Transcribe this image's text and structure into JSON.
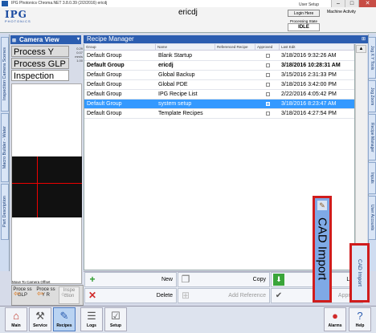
{
  "window": {
    "title": "IPG Photonics Chroma.NET 3.8.0.39 (2/2/2016)    ericdj",
    "minimize": "–",
    "maximize": "□",
    "close": "✕"
  },
  "header": {
    "logo_main": "IPG",
    "logo_sub": "PHOTONICS",
    "username": "ericdj",
    "user_setup": "User Setup",
    "login_button": "Login Here",
    "processing_state_label": "Processing State",
    "processing_state": "IDLE",
    "machine_activity": "Machine Activity"
  },
  "left_tabs": [
    "Inspection Camera Scenes",
    "Macro Builder - Water",
    "Part Description"
  ],
  "camera": {
    "title": "Camera View",
    "modes": [
      "Process Y",
      "Process GLP",
      "Inspection"
    ],
    "readouts": [
      "0.29",
      "0.07",
      "mm/s",
      "1.00"
    ],
    "move_offset_label": "Move To Camera Offset",
    "move_buttons": [
      {
        "label": "Proce ss GLP"
      },
      {
        "label": "Proce ss Y R"
      },
      {
        "label": "Inspe ction"
      }
    ]
  },
  "recipe_manager": {
    "title": "Recipe Manager",
    "columns": [
      "Group",
      "Name",
      "Referenced Recipe",
      "Approved",
      "Last Edit"
    ],
    "rows": [
      {
        "group": "Default Group",
        "name": "Blank Startup",
        "ref": "",
        "edit": "3/18/2016 9:32:26 AM",
        "bold": false,
        "selected": false
      },
      {
        "group": "Default Group",
        "name": "ericdj",
        "ref": "",
        "edit": "3/18/2016 10:28:31 AM",
        "bold": true,
        "selected": false
      },
      {
        "group": "Default Group",
        "name": "Global Backup",
        "ref": "",
        "edit": "3/15/2016 2:31:33 PM",
        "bold": false,
        "selected": false
      },
      {
        "group": "Default Group",
        "name": "Global PDE",
        "ref": "",
        "edit": "3/18/2016 3:42:00 PM",
        "bold": false,
        "selected": false
      },
      {
        "group": "Default Group",
        "name": "IPG Recipe List",
        "ref": "",
        "edit": "2/22/2016 4:05:42 PM",
        "bold": false,
        "selected": false
      },
      {
        "group": "Default Group",
        "name": "system setup",
        "ref": "",
        "edit": "3/18/2016 8:23:47 AM",
        "bold": false,
        "selected": true
      },
      {
        "group": "Default Group",
        "name": "Template Recipes",
        "ref": "",
        "edit": "3/18/2016 4:27:54 PM",
        "bold": false,
        "selected": false
      }
    ],
    "scroll_up": "▲",
    "scroll_down": "▼"
  },
  "actions": {
    "new": "New",
    "copy": "Copy",
    "load": "Load",
    "delete": "Delete",
    "add_reference": "Add Reference",
    "approve": "Approve"
  },
  "cad_import_popup": "CAD Import",
  "right_tabs": [
    "Jog X Y Tools",
    "Jog Zoom",
    "Recipe Manager",
    "Inputs",
    "User Accounts",
    "CAD Import"
  ],
  "bottom_nav": [
    {
      "label": "Main",
      "icon": "home-icon"
    },
    {
      "label": "Service",
      "icon": "service-icon"
    },
    {
      "label": "Recipes",
      "icon": "brush-icon"
    },
    {
      "label": "Logs",
      "icon": "logs-icon"
    },
    {
      "label": "Setup",
      "icon": "setup-icon"
    },
    {
      "label": "Alarms",
      "icon": "alarm-icon"
    },
    {
      "label": "Help",
      "icon": "help-icon"
    }
  ],
  "colors": {
    "header_blue": "#2b5db0",
    "selection_blue": "#3399ff",
    "highlight_red": "#d01c1c"
  }
}
